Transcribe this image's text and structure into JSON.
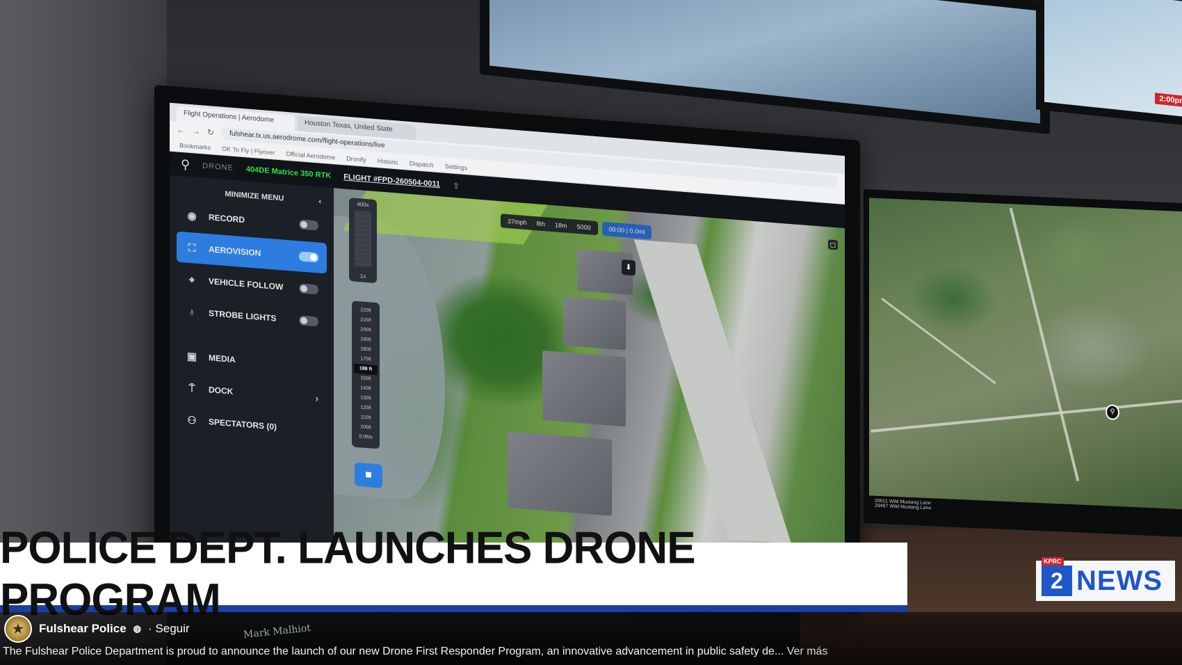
{
  "browser": {
    "tabs": [
      {
        "label": "Flight Operations | Aerodome"
      },
      {
        "label": "Houston Texas, United State"
      }
    ],
    "address": "fulshear.tx.us.aerodrome.com/flight-operations/live",
    "bookmarks": [
      "Bookmarks",
      "OK To Fly | Flyover",
      "Official Aerodome",
      "Dronify",
      "Historic",
      "Dispatch",
      "Settings"
    ]
  },
  "app": {
    "brand": "DRONE",
    "drone_model": "404DE Matrice 350 RTK",
    "flight_id": "FLIGHT #FPD-260504-0011",
    "sidebar": {
      "minimize_label": "MINIMIZE MENU",
      "items": [
        {
          "label": "RECORD",
          "icon": "record-icon",
          "toggle": false
        },
        {
          "label": "AEROVISION",
          "icon": "aerovision-icon",
          "toggle": true
        },
        {
          "label": "VEHICLE FOLLOW",
          "icon": "vehicle-follow-icon",
          "toggle": false
        },
        {
          "label": "STROBE LIGHTS",
          "icon": "strobe-icon",
          "toggle": false
        },
        {
          "label": "MEDIA",
          "icon": "media-icon"
        },
        {
          "label": "DOCK",
          "icon": "dock-icon"
        },
        {
          "label": "SPECTATORS (0)",
          "icon": "spectators-icon"
        }
      ]
    },
    "hud": {
      "speed": "37mph",
      "battery": "8th",
      "distance": "18m",
      "heading": "5000",
      "timer": "00:00 | 0.0ml"
    },
    "zoom": {
      "top": "400x",
      "value": "1x"
    },
    "altitude_ticks": [
      "225ft",
      "215ft",
      "205ft",
      "195ft",
      "185ft",
      "175ft",
      "188 ft",
      "155ft",
      "145ft",
      "135ft",
      "125ft",
      "115ft",
      "105ft"
    ],
    "altitude_current_index": 6,
    "altitude_bottom": "0.0ft/s"
  },
  "map": {
    "footer": [
      "29011 Wild Mustang Lane",
      "29497 Wild Mustang Lane"
    ]
  },
  "broadcast": {
    "headline": "POLICE DEPT. LAUNCHES DRONE PROGRAM",
    "station_tag": "KPRC",
    "station_number": "2",
    "station_name": "NEWS"
  },
  "post": {
    "author": "Fulshear Police",
    "follow": "· Seguir",
    "caption": "The Fulshear Police Department is proud to announce the launch of our new Drone First Responder Program, an innovative advancement in public safety de...",
    "see_more": "Ver más",
    "nameplate": "Mark Malhiot"
  }
}
